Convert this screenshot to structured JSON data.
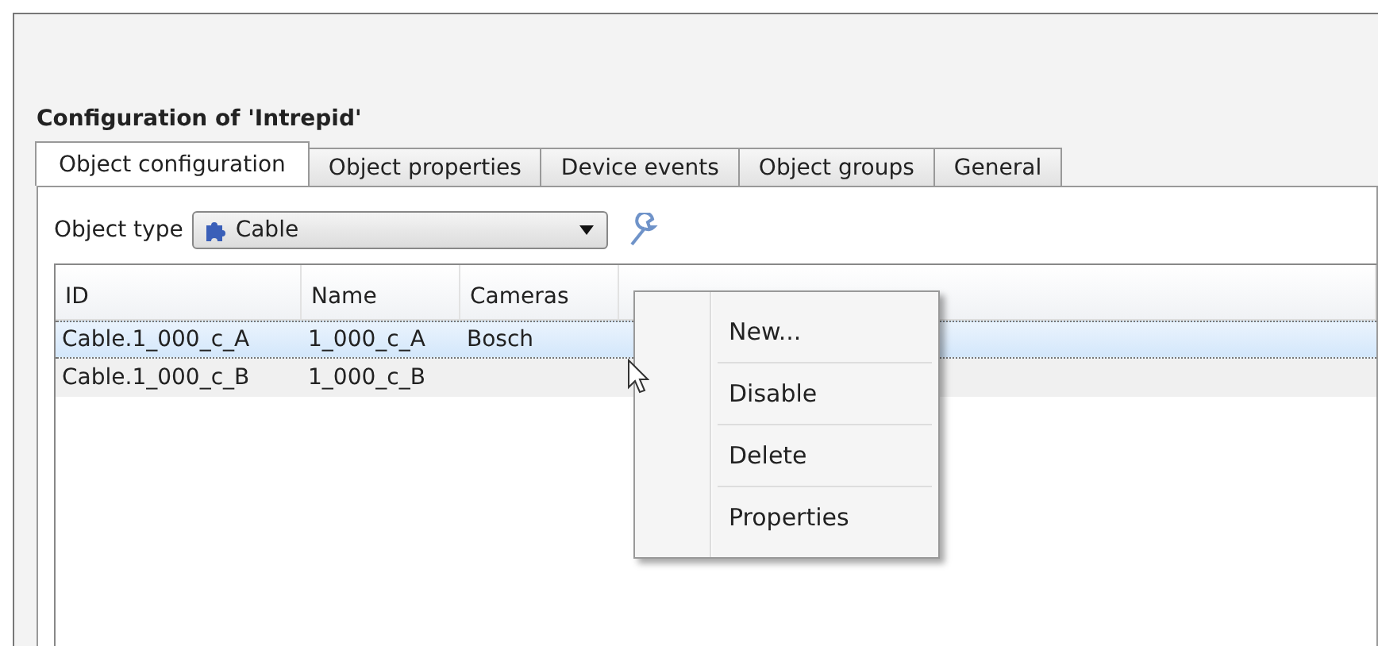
{
  "title": "Configuration of 'Intrepid'",
  "tabs": [
    {
      "label": "Object configuration",
      "selected": true
    },
    {
      "label": "Object properties",
      "selected": false
    },
    {
      "label": "Device events",
      "selected": false
    },
    {
      "label": "Object groups",
      "selected": false
    },
    {
      "label": "General",
      "selected": false
    }
  ],
  "object_type": {
    "label": "Object type",
    "value": "Cable"
  },
  "table": {
    "columns": [
      "ID",
      "Name",
      "Cameras"
    ],
    "rows": [
      {
        "cells": [
          "Cable.1_000_c_A",
          "1_000_c_A",
          "Bosch"
        ],
        "selected": true
      },
      {
        "cells": [
          "Cable.1_000_c_B",
          "1_000_c_B",
          ""
        ],
        "selected": false
      }
    ]
  },
  "context_menu": [
    "New...",
    "Disable",
    "Delete",
    "Properties"
  ]
}
